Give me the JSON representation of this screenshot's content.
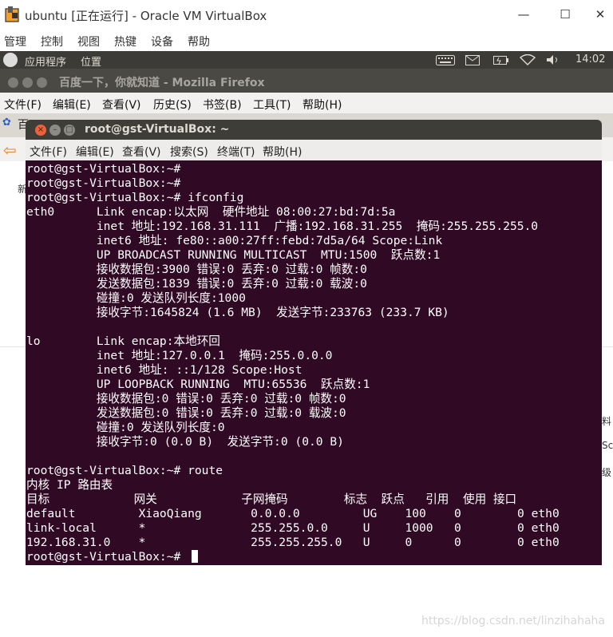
{
  "vbox": {
    "title": "ubuntu [正在运行] - Oracle VM VirtualBox",
    "controls": [
      "—",
      "☐",
      "✕"
    ],
    "menu": [
      "管理",
      "控制",
      "视图",
      "热键",
      "设备",
      "帮助"
    ]
  },
  "ubuntu_panel": {
    "apps": "应用程序",
    "places": "位置",
    "clock": "14:02"
  },
  "firefox": {
    "title": "百度一下，你就知道 - Mozilla Firefox",
    "menu": [
      "文件(F)",
      "编辑(E)",
      "查看(V)",
      "历史(S)",
      "书签(B)",
      "工具(T)",
      "帮助(H)"
    ],
    "tab_label_fragment": "百",
    "side_fragments": [
      "新",
      "料",
      "Sci",
      "级"
    ]
  },
  "terminal": {
    "title": "root@gst-VirtualBox: ~",
    "menu": [
      "文件(F)",
      "编辑(E)",
      "查看(V)",
      "搜索(S)",
      "终端(T)",
      "帮助(H)"
    ],
    "lines": [
      "root@gst-VirtualBox:~#",
      "root@gst-VirtualBox:~#",
      "root@gst-VirtualBox:~# ifconfig",
      "eth0      Link encap:以太网  硬件地址 08:00:27:bd:7d:5a",
      "          inet 地址:192.168.31.111  广播:192.168.31.255  掩码:255.255.255.0",
      "          inet6 地址: fe80::a00:27ff:febd:7d5a/64 Scope:Link",
      "          UP BROADCAST RUNNING MULTICAST  MTU:1500  跃点数:1",
      "          接收数据包:3900 错误:0 丢弃:0 过载:0 帧数:0",
      "          发送数据包:1839 错误:0 丢弃:0 过载:0 载波:0",
      "          碰撞:0 发送队列长度:1000",
      "          接收字节:1645824 (1.6 MB)  发送字节:233763 (233.7 KB)",
      "",
      "lo        Link encap:本地环回",
      "          inet 地址:127.0.0.1  掩码:255.0.0.0",
      "          inet6 地址: ::1/128 Scope:Host",
      "          UP LOOPBACK RUNNING  MTU:65536  跃点数:1",
      "          接收数据包:0 错误:0 丢弃:0 过载:0 帧数:0",
      "          发送数据包:0 错误:0 丢弃:0 过载:0 载波:0",
      "          碰撞:0 发送队列长度:0",
      "          接收字节:0 (0.0 B)  发送字节:0 (0.0 B)",
      "",
      "root@gst-VirtualBox:~# route",
      "内核 IP 路由表",
      "目标            网关            子网掩码        标志  跃点   引用  使用 接口",
      "default         XiaoQiang       0.0.0.0         UG    100    0        0 eth0",
      "link-local      *               255.255.0.0     U     1000   0        0 eth0",
      "192.168.31.0    *               255.255.255.0   U     0      0        0 eth0",
      "root@gst-VirtualBox:~# "
    ]
  },
  "watermark": "https://blog.csdn.net/linzihahaha"
}
